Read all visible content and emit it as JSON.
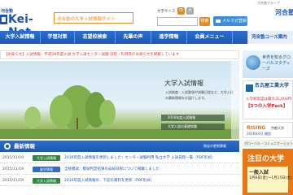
{
  "header": {
    "brand_small": "河合塾",
    "brand_main": "Kei-Net",
    "subtitle": "河合塾の大学入試情報サイト",
    "font_size_label": "文字サイズ",
    "font_size_medium": "中",
    "font_size_large": "大",
    "search_button": "検索",
    "mail_magazine": "メルマガ登録",
    "corp_label": "河合塾グループ",
    "corp_logo": "河合塾"
  },
  "nav": {
    "items": [
      "大学入試情報",
      "学習対策",
      "志望校検索",
      "先輩の声",
      "進学情報",
      "会員メニュー"
    ],
    "koza": "河合塾コース案内"
  },
  "notice": "【お知らせ】入試情報：平成28年度入試 大学入試センター試験 日程・科目等のお知らせを掲載しています",
  "hero": {
    "title": "大学入試情報",
    "description": "入試制度・入試要項や試験日程など、大学入試の最新情報をお届けします。",
    "btn1": "2016年度入試情報",
    "btn2": "大学入試の基礎知識"
  },
  "ads": {
    "globe_text": "世界を知るグローバルスタディーズ",
    "univ_name": "名古屋工業大学",
    "univ_line1": "入学初年度は最大35,000円",
    "univ_line2": "【3つの入学Pack】",
    "rising_logo": "RISING",
    "rising_date": "2016年4月 開設",
    "rising_right": "京都大学",
    "gcom": "グローバル・コミュニケーション学部",
    "chumoku_title": "注目の大学",
    "chumoku_label": "一般入試",
    "chumoku_date": "1月8日(金)〜1月15日(金)"
  },
  "news": {
    "title": "最新情報",
    "more": "過去の更新情報",
    "rows": [
      {
        "date": "2015/11/19",
        "category": "大学入試情報",
        "text": "2016年度入試情報を更新しました：センター試験利用 私立大学 入試日程一覧（PDF形式）",
        "new": "NEW"
      },
      {
        "date": "2015/11/19",
        "category": "進学情報",
        "text": "全統模試：模試判定結果の返却日程について掲載しました",
        "new": ""
      },
      {
        "date": "2015/11/19",
        "category": "大学入試情報",
        "text": "2016年度入試情報の、下記の資料を更新（PDF形式）",
        "new": ""
      }
    ]
  },
  "colors": {
    "brand_blue": "#1a56b6",
    "accent_orange": "#e58a1d",
    "nav_blue": "#2c6ed0"
  }
}
